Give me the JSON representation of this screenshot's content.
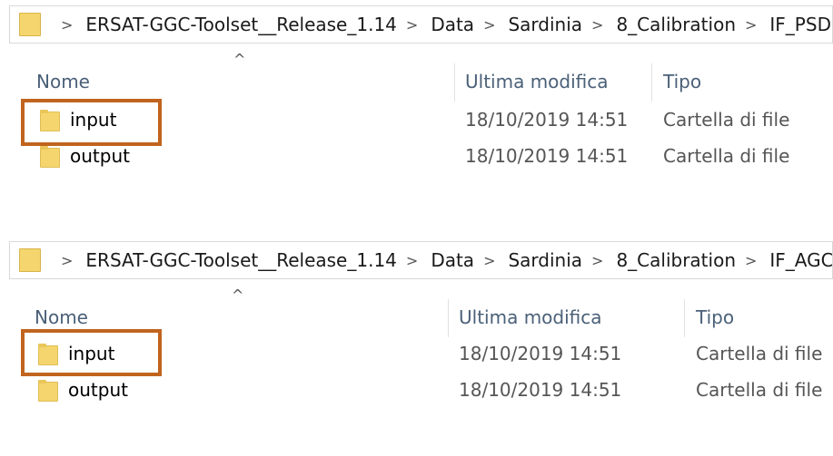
{
  "panels": [
    {
      "breadcrumb": [
        "ERSAT-GGC-Toolset__Release_1.14",
        "Data",
        "Sardinia",
        "8_Calibration",
        "IF_PSD"
      ],
      "columns": {
        "name": "Nome",
        "modified": "Ultima modifica",
        "type": "Tipo"
      },
      "rows": [
        {
          "name": "input",
          "modified": "18/10/2019 14:51",
          "type": "Cartella di file"
        },
        {
          "name": "output",
          "modified": "18/10/2019 14:51",
          "type": "Cartella di file"
        }
      ]
    },
    {
      "breadcrumb": [
        "ERSAT-GGC-Toolset__Release_1.14",
        "Data",
        "Sardinia",
        "8_Calibration",
        "IF_AGC"
      ],
      "columns": {
        "name": "Nome",
        "modified": "Ultima modifica",
        "type": "Tipo"
      },
      "rows": [
        {
          "name": "input",
          "modified": "18/10/2019 14:51",
          "type": "Cartella di file"
        },
        {
          "name": "output",
          "modified": "18/10/2019 14:51",
          "type": "Cartella di file"
        }
      ]
    }
  ],
  "icons": {
    "folder": "folder-icon",
    "chevron": "chevron-right-icon",
    "sort": "sort-up-icon"
  },
  "colors": {
    "highlight": "#c0641e",
    "folder": "#f5d56e",
    "header_text": "#4a6078"
  }
}
